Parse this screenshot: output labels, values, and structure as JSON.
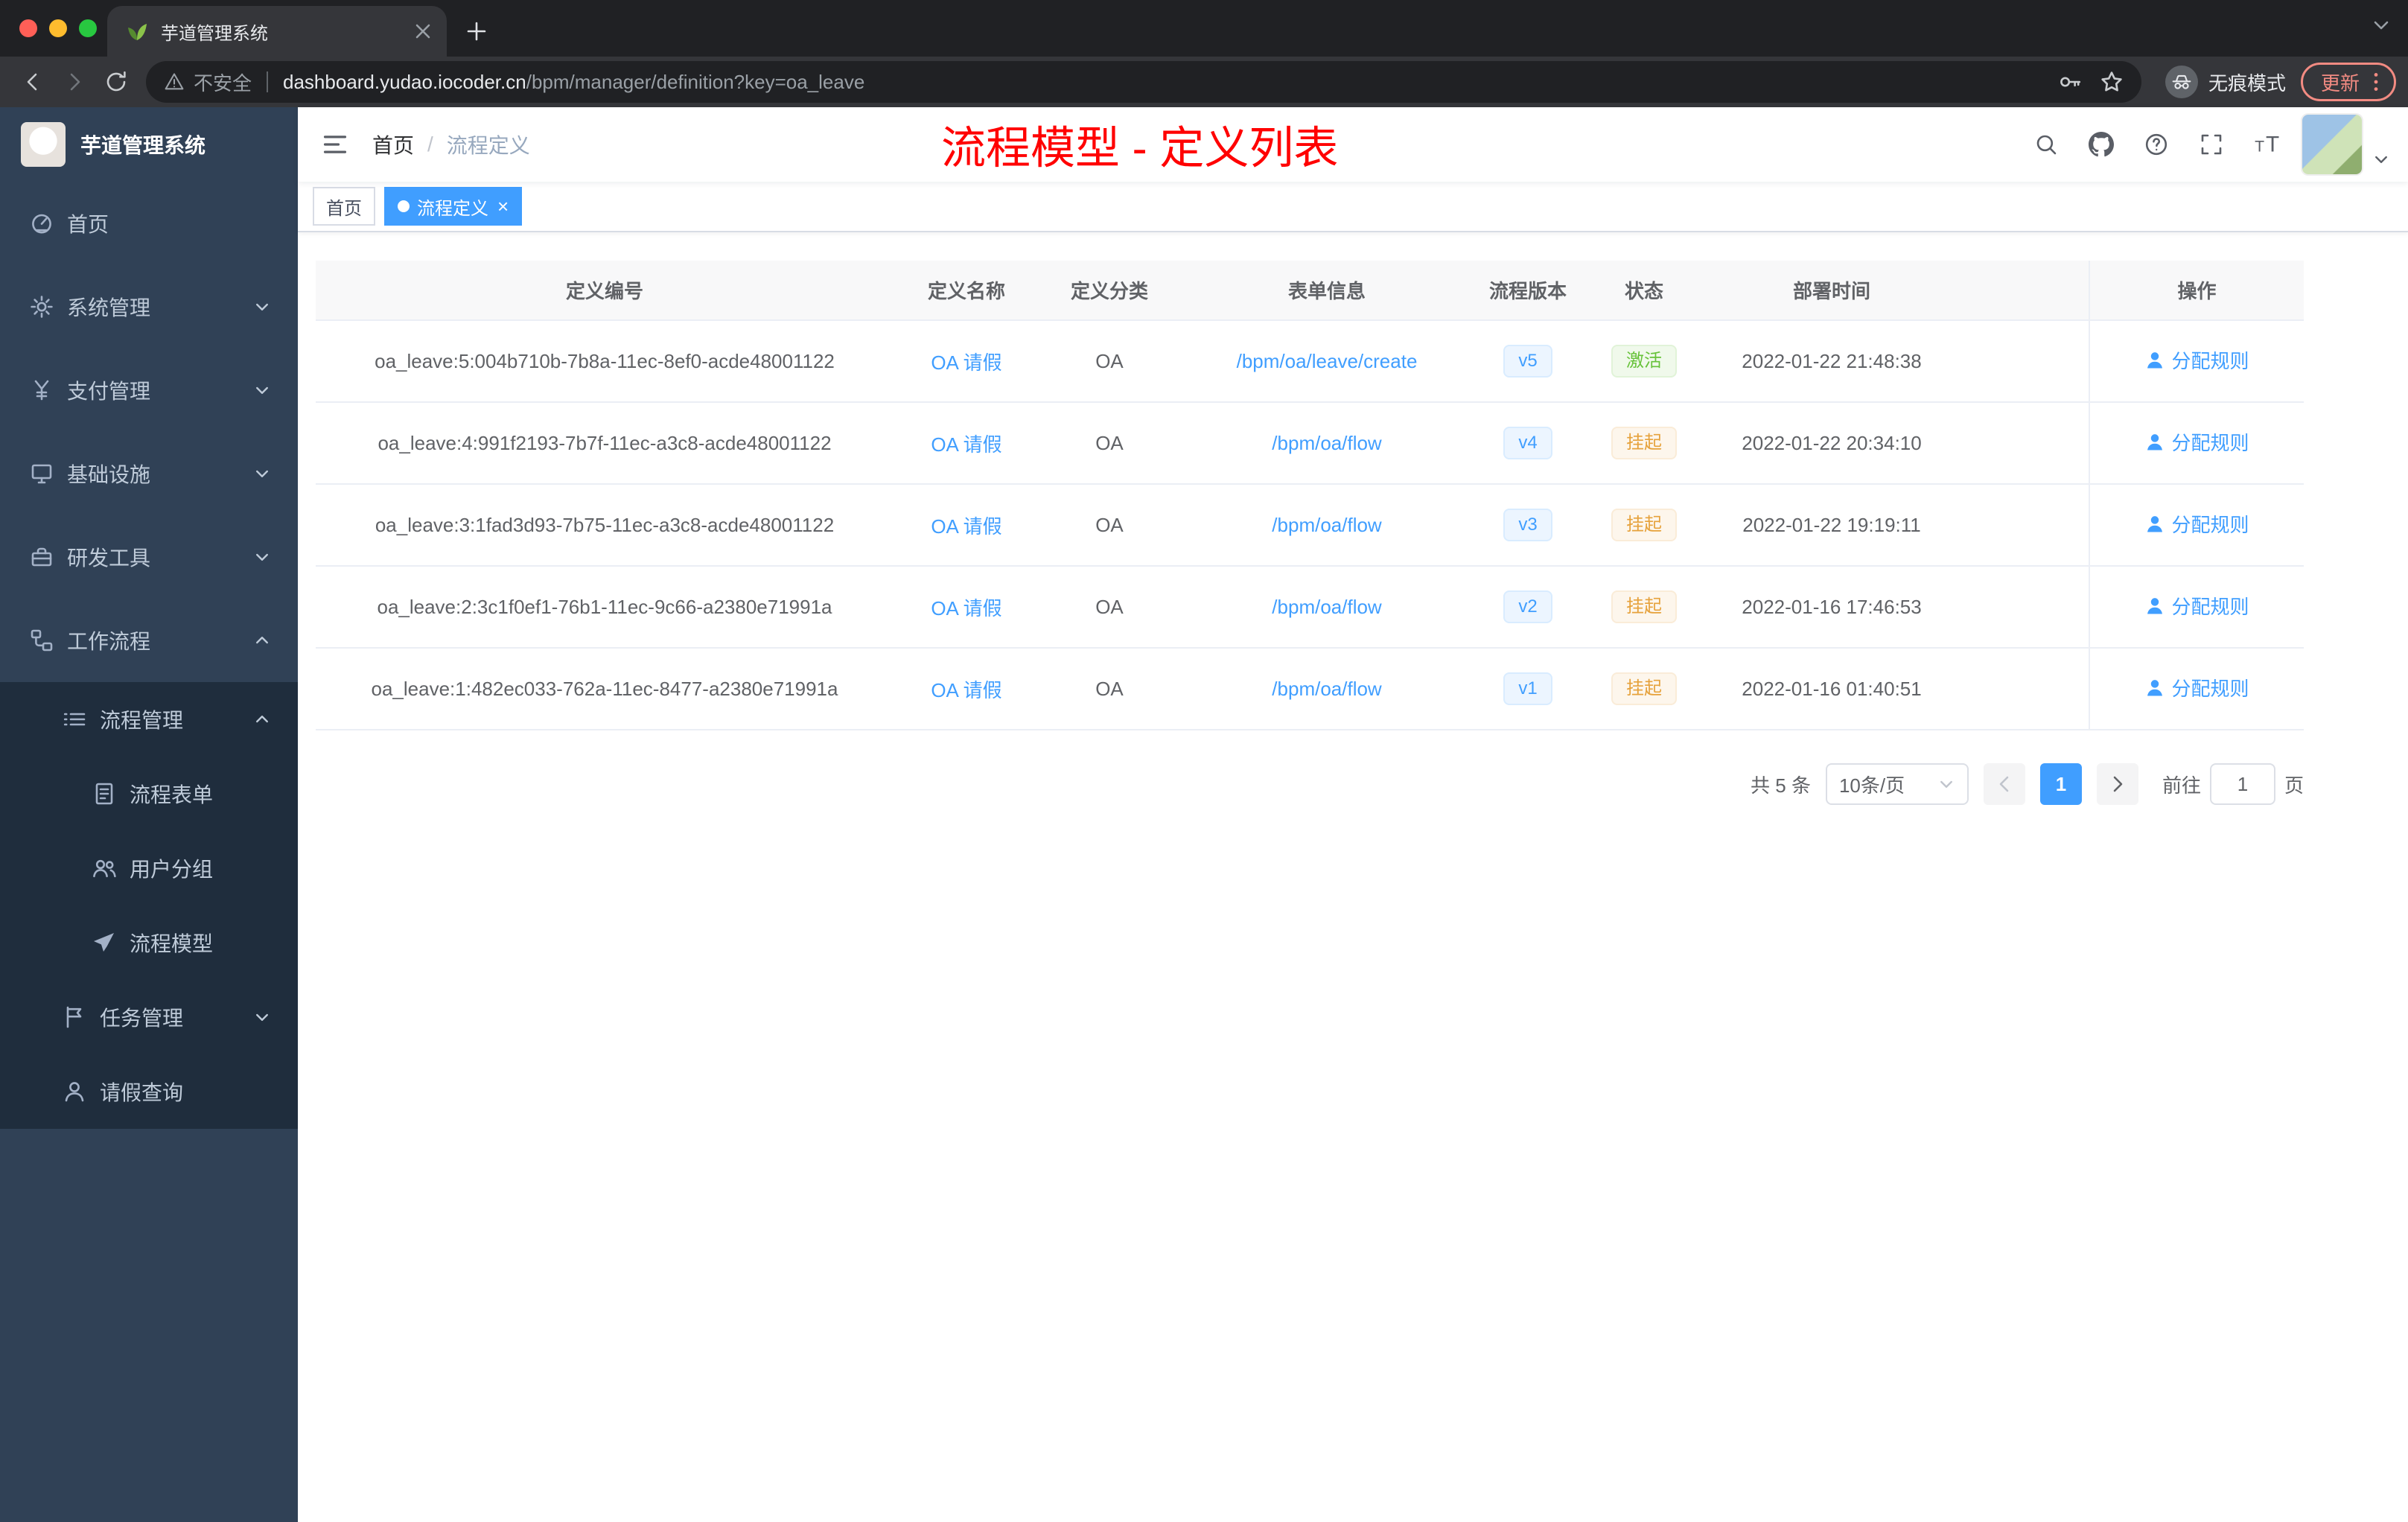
{
  "browser": {
    "tab": {
      "title": "芋道管理系统"
    },
    "address": {
      "security": "不安全",
      "url_host": "dashboard.yudao.iocoder.cn",
      "url_path": "/bpm/manager/definition?key=oa_leave"
    },
    "incognito_label": "无痕模式",
    "update_label": "更新"
  },
  "sidebar": {
    "title": "芋道管理系统",
    "menu": [
      {
        "label": "首页",
        "icon": "dashboard-icon",
        "arrow": null,
        "level": 1,
        "dark": false
      },
      {
        "label": "系统管理",
        "icon": "gear-icon",
        "arrow": "down",
        "level": 1,
        "dark": false
      },
      {
        "label": "支付管理",
        "icon": "yen-icon",
        "arrow": "down",
        "level": 1,
        "dark": false
      },
      {
        "label": "基础设施",
        "icon": "monitor-icon",
        "arrow": "down",
        "level": 1,
        "dark": false
      },
      {
        "label": "研发工具",
        "icon": "toolbox-icon",
        "arrow": "down",
        "level": 1,
        "dark": false
      },
      {
        "label": "工作流程",
        "icon": "workflow-icon",
        "arrow": "up",
        "level": 1,
        "dark": false
      },
      {
        "label": "流程管理",
        "icon": "list-icon",
        "arrow": "up",
        "level": 2,
        "dark": true
      },
      {
        "label": "流程表单",
        "icon": "form-icon",
        "arrow": null,
        "level": 3,
        "dark": true
      },
      {
        "label": "用户分组",
        "icon": "users-icon",
        "arrow": null,
        "level": 3,
        "dark": true
      },
      {
        "label": "流程模型",
        "icon": "send-icon",
        "arrow": null,
        "level": 3,
        "dark": true
      },
      {
        "label": "任务管理",
        "icon": "flag-icon",
        "arrow": "down",
        "level": 2,
        "dark": true
      },
      {
        "label": "请假查询",
        "icon": "user-icon",
        "arrow": null,
        "level": 2,
        "dark": true
      }
    ]
  },
  "header": {
    "breadcrumb": [
      "首页",
      "流程定义"
    ],
    "annotation": "流程模型 - 定义列表"
  },
  "tags": [
    {
      "label": "首页",
      "active": false,
      "closable": false
    },
    {
      "label": "流程定义",
      "active": true,
      "closable": true
    }
  ],
  "table": {
    "columns": [
      "定义编号",
      "定义名称",
      "定义分类",
      "表单信息",
      "流程版本",
      "状态",
      "部署时间",
      "操作"
    ],
    "action_label": "分配规则",
    "rows": [
      {
        "id": "oa_leave:5:004b710b-7b8a-11ec-8ef0-acde48001122",
        "name": "OA 请假",
        "category": "OA",
        "form": "/bpm/oa/leave/create",
        "version": "v5",
        "status": "激活",
        "status_type": "success",
        "time": "2022-01-22 21:48:38"
      },
      {
        "id": "oa_leave:4:991f2193-7b7f-11ec-a3c8-acde48001122",
        "name": "OA 请假",
        "category": "OA",
        "form": "/bpm/oa/flow",
        "version": "v4",
        "status": "挂起",
        "status_type": "warning",
        "time": "2022-01-22 20:34:10"
      },
      {
        "id": "oa_leave:3:1fad3d93-7b75-11ec-a3c8-acde48001122",
        "name": "OA 请假",
        "category": "OA",
        "form": "/bpm/oa/flow",
        "version": "v3",
        "status": "挂起",
        "status_type": "warning",
        "time": "2022-01-22 19:19:11"
      },
      {
        "id": "oa_leave:2:3c1f0ef1-76b1-11ec-9c66-a2380e71991a",
        "name": "OA 请假",
        "category": "OA",
        "form": "/bpm/oa/flow",
        "version": "v2",
        "status": "挂起",
        "status_type": "warning",
        "time": "2022-01-16 17:46:53"
      },
      {
        "id": "oa_leave:1:482ec033-762a-11ec-8477-a2380e71991a",
        "name": "OA 请假",
        "category": "OA",
        "form": "/bpm/oa/flow",
        "version": "v1",
        "status": "挂起",
        "status_type": "warning",
        "time": "2022-01-16 01:40:51"
      }
    ]
  },
  "pagination": {
    "total": "共 5 条",
    "page_size": "10条/页",
    "current_page": "1",
    "goto_label": "前往",
    "goto_value": "1",
    "page_unit": "页"
  },
  "colors": {
    "accent": "#409eff",
    "annotation_red": "#ff0000",
    "success": "#67c23a",
    "warning": "#e6a23c",
    "sidebar_bg": "#304156",
    "submenu_bg": "#1f2d3d"
  }
}
